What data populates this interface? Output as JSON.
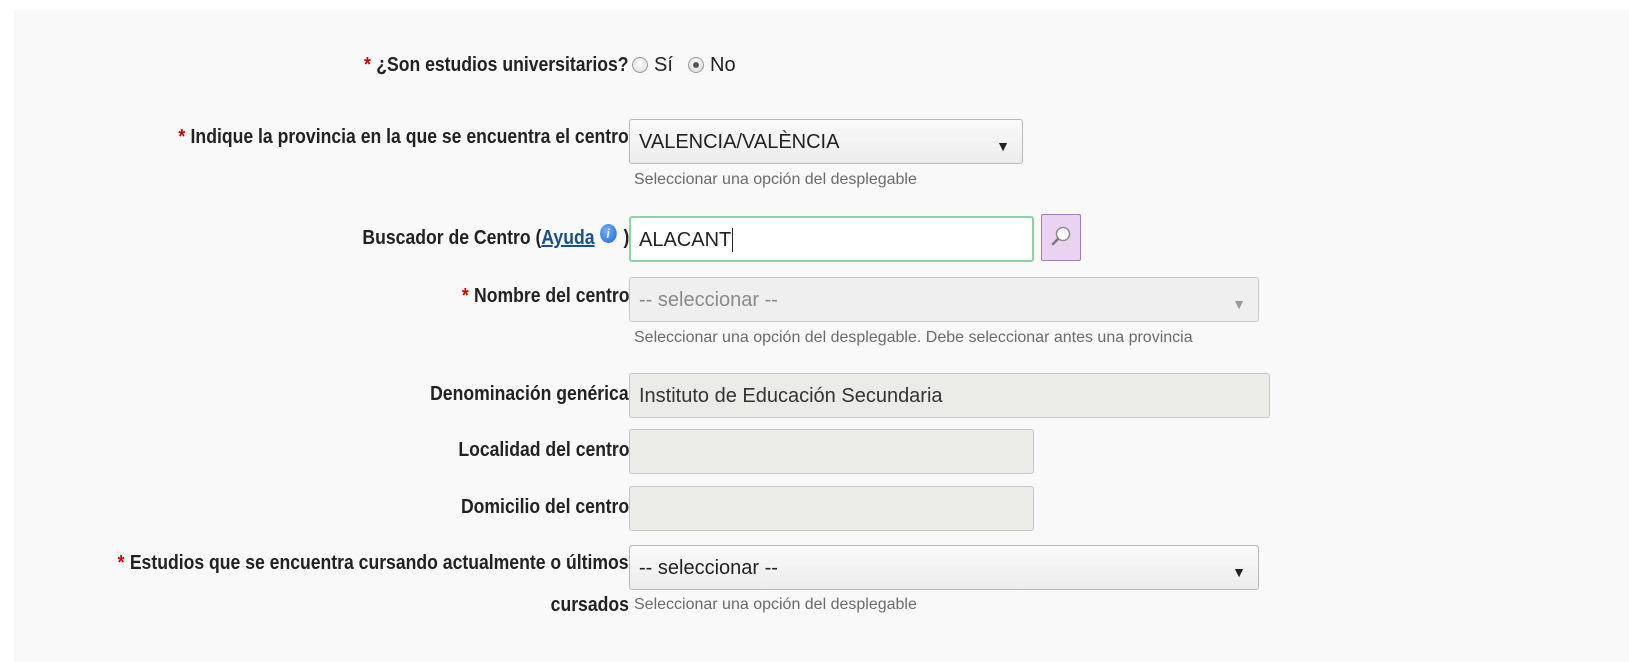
{
  "required_mark": "*",
  "university": {
    "label": "¿Son estudios universitarios?",
    "options": [
      "Sí",
      "No"
    ],
    "selected": "No"
  },
  "province": {
    "label": "Indique la provincia en la que se encuentra el centro",
    "value": "VALENCIA/VALÈNCIA",
    "hint": "Seleccionar una opción del desplegable"
  },
  "center_search": {
    "label": "Buscador de Centro (",
    "help_link": "Ayuda",
    "label_end": ")",
    "value": "ALACANT",
    "button_icon": "magnifier-icon"
  },
  "center_name": {
    "label": "Nombre del centro",
    "value": "-- seleccionar --",
    "hint": "Seleccionar una opción del desplegable. Debe seleccionar antes una provincia"
  },
  "generic_name": {
    "label": "Denominación genérica",
    "value": "Instituto de Educación Secundaria"
  },
  "locality": {
    "label": "Localidad del centro",
    "value": ""
  },
  "address": {
    "label": "Domicilio del centro",
    "value": ""
  },
  "studies": {
    "label_line1": "Estudios que se encuentra cursando actualmente o últimos",
    "label_line2": "cursados",
    "value": "-- seleccionar --",
    "hint": "Seleccionar una opción del desplegable"
  },
  "colors": {
    "required": "#cc0000",
    "link": "#1a4f8b",
    "search_border": "#8fd1a4",
    "search_button_bg": "#e9d3f0"
  }
}
